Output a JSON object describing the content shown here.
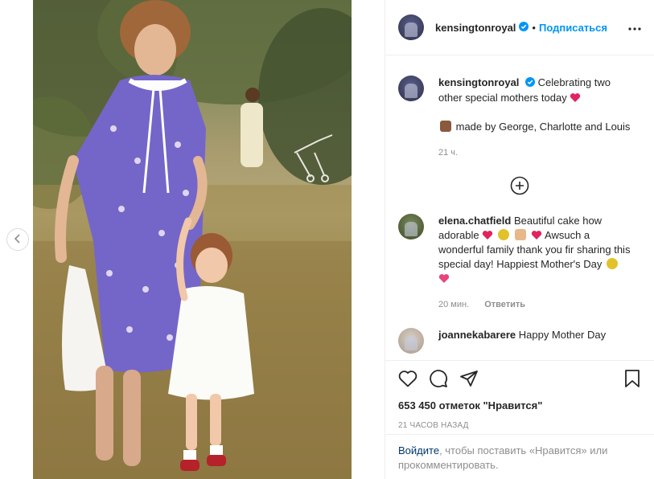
{
  "post": {
    "image_alt": "",
    "prev_icon": "chevron-left-icon"
  },
  "header": {
    "username": "kensingtonroyal",
    "dot": "•",
    "follow_label": "Подписаться",
    "more_icon": "more-horizontal-icon"
  },
  "caption": {
    "username": "kensingtonroyal",
    "text1": "Celebrating two other special mothers today",
    "text2": "made by George, Charlotte and Louis",
    "time": "21 ч."
  },
  "load_more_icon": "plus-circle-icon",
  "comments": [
    {
      "username": "elena.chatfield",
      "text_a": "Beautiful cake how adorable",
      "text_b": "Awsuch a wonderful family thank you fir sharing this special day! Happiest Mother's Day",
      "time": "20 мин.",
      "reply_label": "Ответить"
    },
    {
      "username": "joannekabarere",
      "text": "Happy Mother Day"
    }
  ],
  "actions": {
    "likes": "653 450 отметок \"Нравится\"",
    "time": "21 ЧАСОВ НАЗАД"
  },
  "login": {
    "link": "Войдите",
    "text": ", чтобы поставить «Нравится» или прокомментировать."
  },
  "colors": {
    "accent": "#0095f6",
    "heart": "#ed4956",
    "muted": "#8e8e8e"
  }
}
